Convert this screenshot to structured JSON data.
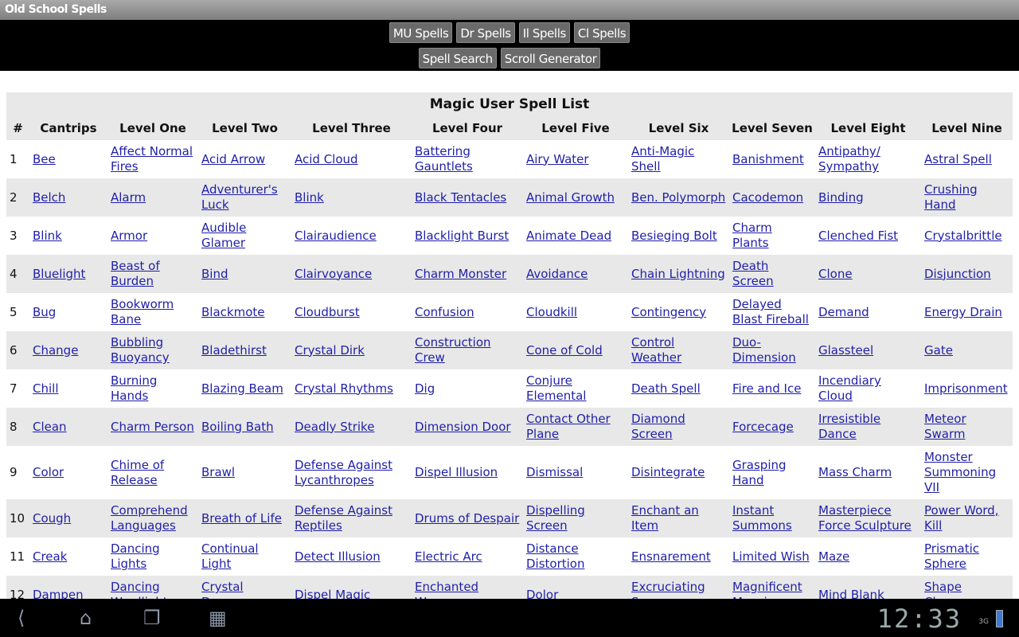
{
  "app": {
    "title": "Old School Spells"
  },
  "toolbar": {
    "row1": [
      "MU Spells",
      "Dr Spells",
      "Il Spells",
      "Cl Spells"
    ],
    "row2": [
      "Spell Search",
      "Scroll Generator"
    ]
  },
  "table": {
    "caption": "Magic User Spell List",
    "headers": [
      "#",
      "Cantrips",
      "Level One",
      "Level Two",
      "Level Three",
      "Level Four",
      "Level Five",
      "Level Six",
      "Level Seven",
      "Level Eight",
      "Level Nine"
    ],
    "rows": [
      [
        "1",
        "Bee",
        "Affect Normal Fires",
        "Acid Arrow",
        "Acid Cloud",
        "Battering Gauntlets",
        "Airy Water",
        "Anti-Magic Shell",
        "Banishment",
        "Antipathy/ Sympathy",
        "Astral Spell"
      ],
      [
        "2",
        "Belch",
        "Alarm",
        "Adventurer's Luck",
        "Blink",
        "Black Tentacles",
        "Animal Growth",
        "Ben. Polymorph",
        "Cacodemon",
        "Binding",
        "Crushing Hand"
      ],
      [
        "3",
        "Blink",
        "Armor",
        "Audible Glamer",
        "Clairaudience",
        "Blacklight Burst",
        "Animate Dead",
        "Besieging Bolt",
        "Charm Plants",
        "Clenched Fist",
        "Crystalbrittle"
      ],
      [
        "4",
        "Bluelight",
        "Beast of Burden",
        "Bind",
        "Clairvoyance",
        "Charm Monster",
        "Avoidance",
        "Chain Lightning",
        "Death Screen",
        "Clone",
        "Disjunction"
      ],
      [
        "5",
        "Bug",
        "Bookworm Bane",
        "Blackmote",
        "Cloudburst",
        "Confusion",
        "Cloudkill",
        "Contingency",
        "Delayed Blast Fireball",
        "Demand",
        "Energy Drain"
      ],
      [
        "6",
        "Change",
        "Bubbling Buoyancy",
        "Bladethirst",
        "Crystal Dirk",
        "Construction Crew",
        "Cone of Cold",
        "Control Weather",
        "Duo-Dimension",
        "Glassteel",
        "Gate"
      ],
      [
        "7",
        "Chill",
        "Burning Hands",
        "Blazing Beam",
        "Crystal Rhythms",
        "Dig",
        "Conjure Elemental",
        "Death Spell",
        "Fire and Ice",
        "Incendiary Cloud",
        "Imprisonment"
      ],
      [
        "8",
        "Clean",
        "Charm Person",
        "Boiling Bath",
        "Deadly Strike",
        "Dimension Door",
        "Contact Other Plane",
        "Diamond Screen",
        "Forcecage",
        "Irresistible Dance",
        "Meteor Swarm"
      ],
      [
        "9",
        "Color",
        "Chime of Release",
        "Brawl",
        "Defense Against Lycanthropes",
        "Dispel Illusion",
        "Dismissal",
        "Disintegrate",
        "Grasping Hand",
        "Mass Charm",
        "Monster Summoning VII"
      ],
      [
        "10",
        "Cough",
        "Comprehend Languages",
        "Breath of Life",
        "Defense Against Reptiles",
        "Drums of Despair",
        "Dispelling Screen",
        "Enchant an Item",
        "Instant Summons",
        "Masterpiece Force Sculpture",
        "Power Word, Kill"
      ],
      [
        "11",
        "Creak",
        "Dancing Lights",
        "Continual Light",
        "Detect Illusion",
        "Electric Arc",
        "Distance Distortion",
        "Ensnarement",
        "Limited Wish",
        "Maze",
        "Prismatic Sphere"
      ],
      [
        "12",
        "Dampen",
        "Dancing Wordlights",
        "Crystal Dagger",
        "Dispel Magic",
        "Enchanted Weapon",
        "Dolor",
        "Excruciating Screams",
        "Magnificent Mansion",
        "Mind Blank",
        "Shape Change"
      ]
    ]
  },
  "statusbar": {
    "time": "12:33",
    "network": "3G"
  },
  "colors": {
    "link": "#1f1fa8",
    "row_alt": "#e8e8e8",
    "button": "#6a6a6a"
  }
}
